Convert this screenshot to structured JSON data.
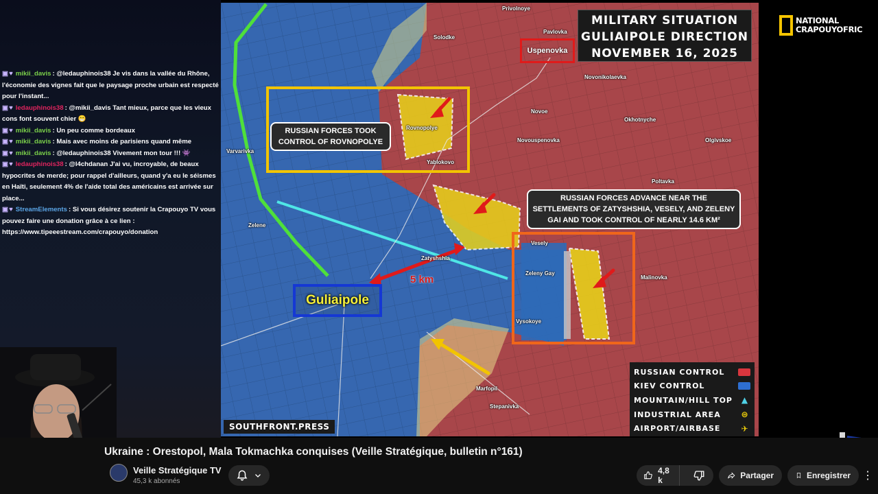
{
  "chat": {
    "messages": [
      {
        "author": "mikii_davis",
        "color": "#7bd14a",
        "text": ": @ledauphinois38 Je vis dans la vallée du Rhône, l'économie des vignes fait que le paysage proche urbain est respecté pour l'instant..."
      },
      {
        "author": "ledauphinois38",
        "color": "#e0245e",
        "text": ": @mikii_davis Tant mieux, parce que les vieux cons font souvent chier 😁"
      },
      {
        "author": "mikii_davis",
        "color": "#7bd14a",
        "text": ": Un peu comme bordeaux"
      },
      {
        "author": "mikii_davis",
        "color": "#7bd14a",
        "text": ": Mais avec moins de parisiens quand même"
      },
      {
        "author": "mikii_davis",
        "color": "#7bd14a",
        "text": ": @ledauphinois38 Vivement mon tour !!! 👾"
      },
      {
        "author": "ledauphinois38",
        "color": "#e0245e",
        "text": ": @l4chdanan J'ai vu, incroyable, de beaux hypocrites de merde; pour rappel d'ailleurs, quand y'a eu le séismes en Haïti, seulement 4% de l'aide total des américains est arrivée sur place..."
      },
      {
        "author": "StreamElements",
        "color": "#5aa5e6",
        "text": ": Si vous désirez soutenir la Crapouyo TV vous pouvez faire une donation grâce à ce lien : https://www.tipeeestream.com/crapouyo/donation"
      }
    ]
  },
  "map": {
    "title_lines": [
      "MILITARY SITUATION",
      "GULIAIPOLE DIRECTION",
      "NOVEMBER 16, 2025"
    ],
    "callout_rovnopolye": "RUSSIAN FORCES TOOK CONTROL OF ROVNOPOLYE",
    "callout_advance": "RUSSIAN FORCES ADVANCE NEAR THE SETTLEMENTS OF ZATYSHSHIA, VESELY, AND ZELENY GAI AND TOOK CONTROL OF NEARLY 14.6 KM²",
    "distance_label": "5 km",
    "city_main": "Guliaipole",
    "city_highlight": "Uspenovka",
    "places": {
      "privolnoye": "Privolnoye",
      "pavlovka": "Pavlovka",
      "solodke": "Solodke",
      "novonikolaevka": "Novonikolaevka",
      "rovnopolye": "Rovnopolye",
      "yablokovo": "Yablokovo",
      "novoe": "Novoe",
      "okhotnyche": "Okhotnyche",
      "novouspenovka": "Novouspenovka",
      "olgivskoe": "Olgivskoe",
      "poltavka": "Poltavka",
      "varvarivka": "Varvarivka",
      "zelene": "Zelene",
      "zatyshshia": "Zatyshshia",
      "vesely": "Vesely",
      "zeleny_gay": "Zeleny Gay",
      "vysokoye": "Vysokoye",
      "malinovka": "Malinovka",
      "marfopil": "Marfopil",
      "stepanivka": "Stepanivka"
    },
    "legend": [
      {
        "label": "RUSSIAN CONTROL",
        "kind": "swatch",
        "color": "#d9363e"
      },
      {
        "label": "KIEV CONTROL",
        "kind": "swatch",
        "color": "#2e6fd1"
      },
      {
        "label": "MOUNTAIN/HILL TOP",
        "kind": "icon",
        "icon": "mountain-icon",
        "color": "#4fd1e6"
      },
      {
        "label": "INDUSTRIAL AREA",
        "kind": "icon",
        "icon": "factory-icon",
        "color": "#f2d20a"
      },
      {
        "label": "AIRPORT/AIRBASE",
        "kind": "icon",
        "icon": "airplane-icon",
        "color": "#f2d20a"
      }
    ],
    "brand": "SOUTHFRONT.PRESS",
    "colors": {
      "russian": "#b8414a",
      "kiev": "#2d6ab8",
      "captured": "#e8d21a"
    }
  },
  "overlay": {
    "ng_logo_line1": "NATIONAL",
    "ng_logo_line2": "CRAPOUYOFRIC"
  },
  "video": {
    "title": "Ukraine : Orestopol, Mala Tokmachka conquises (Veille Stratégique, bulletin n°161)",
    "channel": "Veille Stratégique TV",
    "subscribers": "45,3 k abonnés",
    "likes": "4,8 k",
    "share_label": "Partager",
    "save_label": "Enregistrer"
  }
}
